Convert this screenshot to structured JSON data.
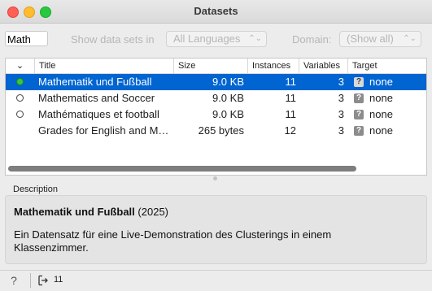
{
  "window": {
    "title": "Datasets"
  },
  "filters": {
    "search_value": "Math",
    "show_label": "Show data sets in",
    "language": "All Languages",
    "domain_label": "Domain:",
    "domain": "(Show all)"
  },
  "table": {
    "columns": {
      "title": "Title",
      "size": "Size",
      "instances": "Instances",
      "variables": "Variables",
      "target": "Target"
    },
    "rows": [
      {
        "title": "Mathematik und Fußball",
        "size": "9.0 KB",
        "instances": "11",
        "variables": "3",
        "target": "none",
        "status": "local-green"
      },
      {
        "title": "Mathematics and Soccer",
        "size": "9.0 KB",
        "instances": "11",
        "variables": "3",
        "target": "none",
        "status": "remote"
      },
      {
        "title": "Mathématiques et football",
        "size": "9.0 KB",
        "instances": "11",
        "variables": "3",
        "target": "none",
        "status": "remote"
      },
      {
        "title": "Grades for English and M…",
        "size": "265 bytes",
        "instances": "12",
        "variables": "3",
        "target": "none",
        "status": "none"
      }
    ],
    "target_icon": "?"
  },
  "description": {
    "label": "Description",
    "name": "Mathematik und Fußball",
    "year": "(2025)",
    "text": "Ein Datensatz für eine Live-Demonstration des Clusterings in einem Klassenzimmer."
  },
  "status": {
    "help_icon": "?",
    "output_count": "11"
  },
  "colors": {
    "selection": "#0064d1",
    "status_green": "#3fc23f"
  }
}
